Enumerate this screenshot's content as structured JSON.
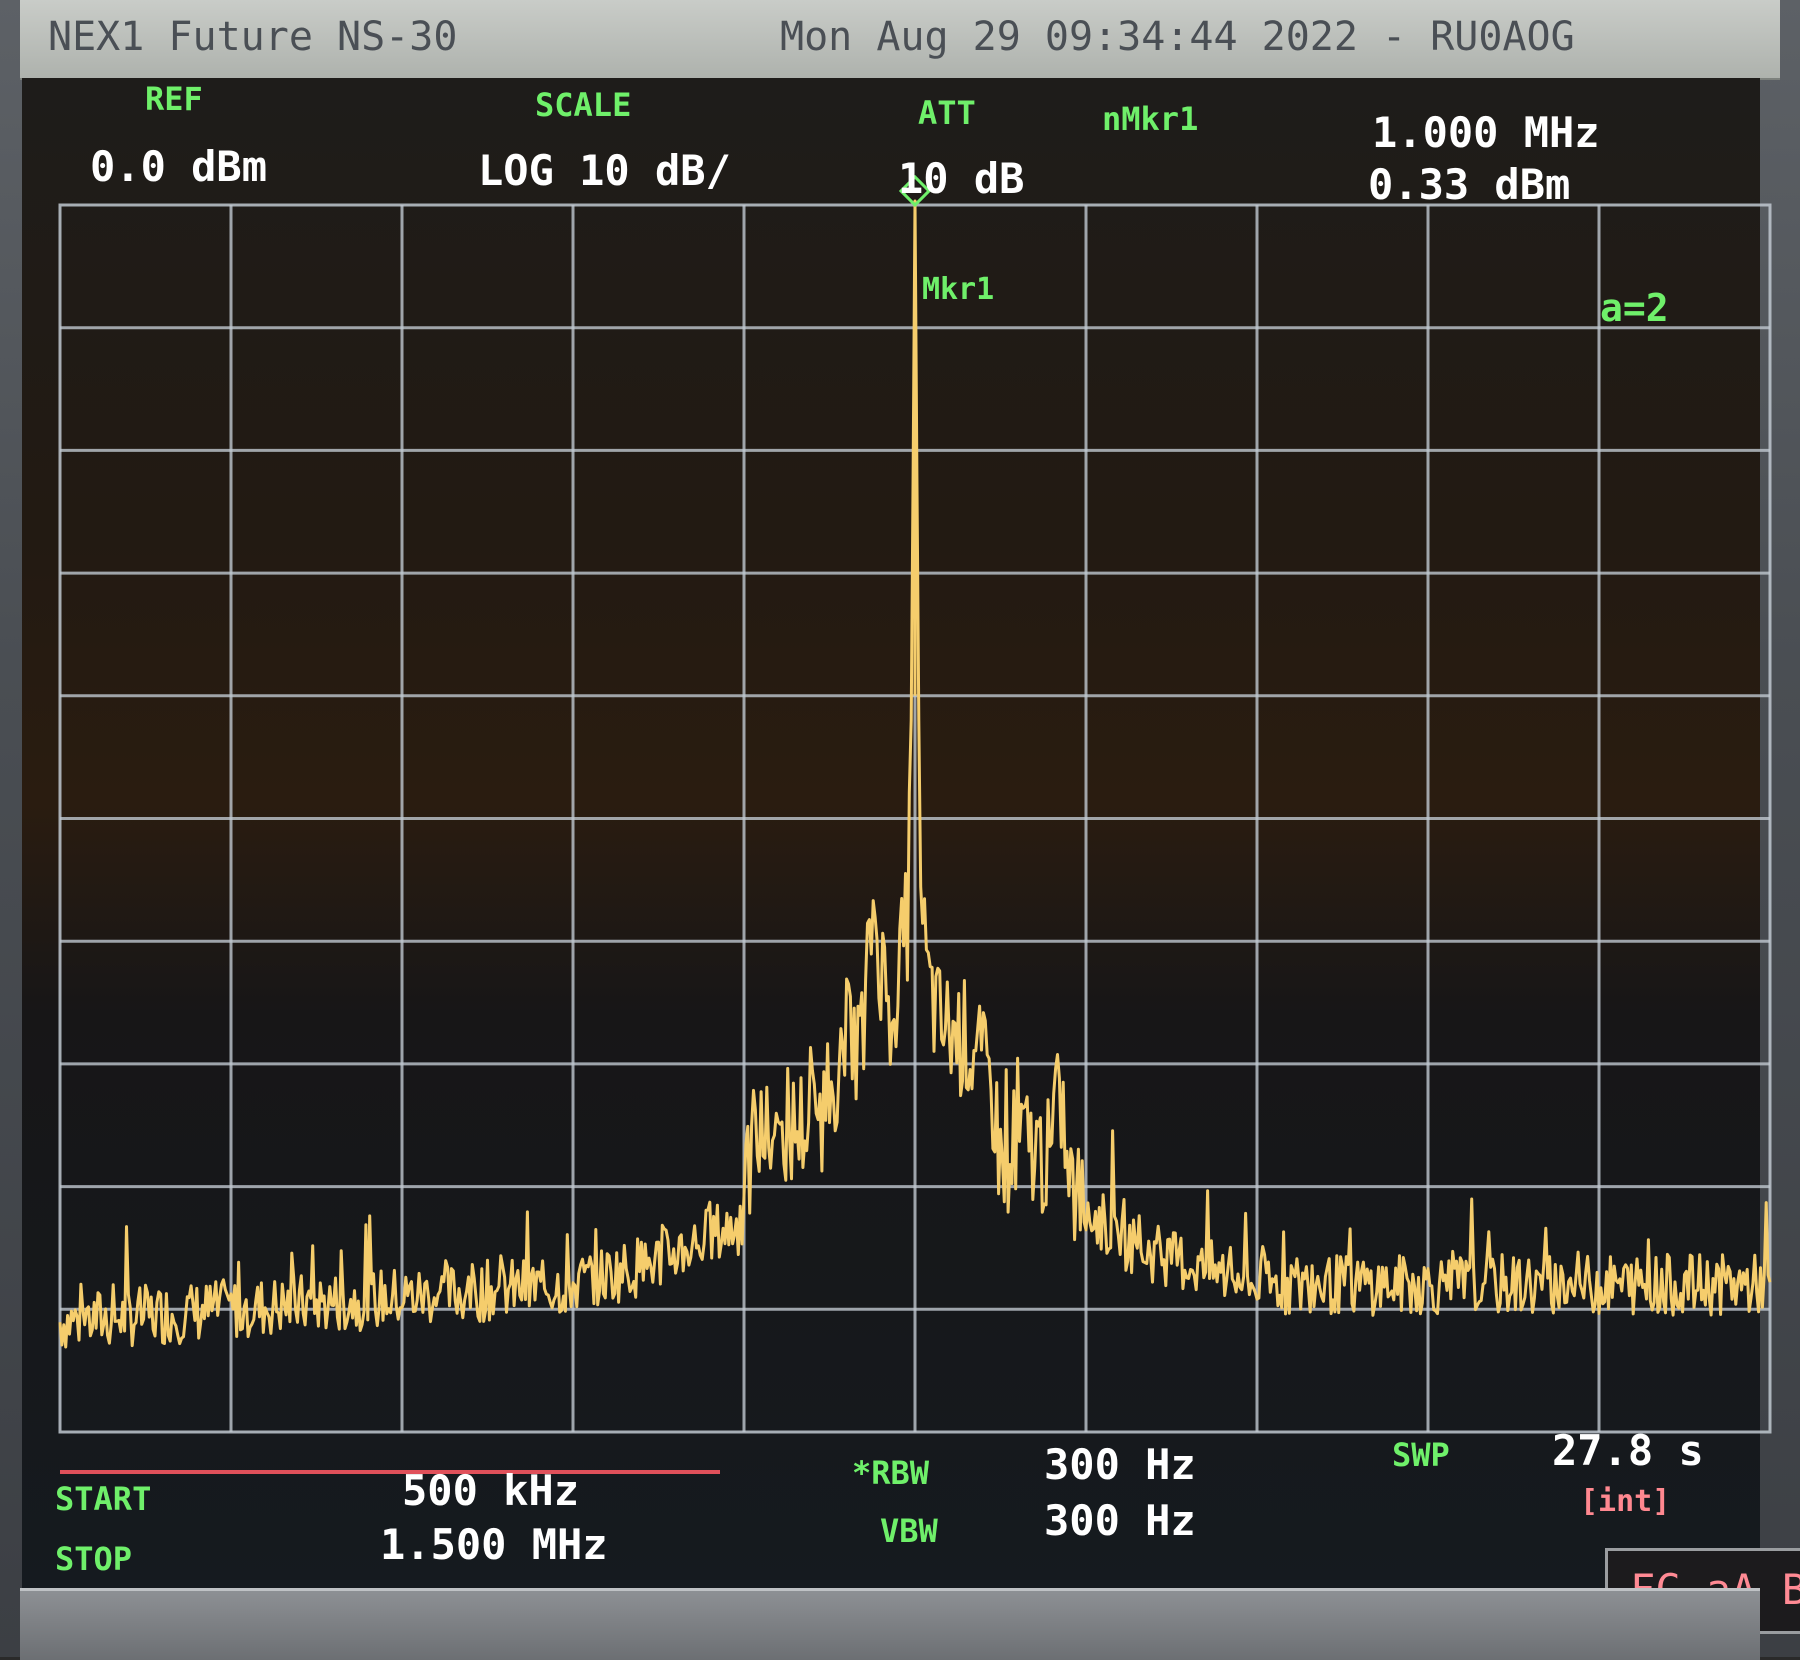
{
  "header": {
    "device": "NEX1 Future NS-30",
    "datetime": "Mon Aug 29 09:34:44 2022 - RU0AOG"
  },
  "top_labels": {
    "ref_label": "REF",
    "ref_value": "0.0 dBm",
    "scale_label": "SCALE",
    "scale_value": "LOG 10 dB/",
    "att_label": "ATT",
    "att_value": "10 dB",
    "marker_label": "nMkr1",
    "marker_freq": "1.000 MHz",
    "marker_level": "0.33 dBm"
  },
  "plot_labels": {
    "marker_tag": "Mkr1",
    "averaging": "a=2"
  },
  "bottom_labels": {
    "start_label": "START",
    "start_value": "500 kHz",
    "stop_label": "STOP",
    "stop_value": "1.500 MHz",
    "rbw_label": "*RBW",
    "rbw_value": "300 Hz",
    "vbw_label": "VBW",
    "vbw_value": "300 Hz",
    "swp_label": "SWP",
    "swp_value": "27.8 s",
    "swp_mode": "[int]"
  },
  "status": {
    "text": "FC aA B"
  },
  "colors": {
    "trace": "#f5cd6c",
    "grid": "#c0c8d0",
    "label_green": "#6ff06a",
    "label_white": "#ffffff",
    "screen_bg": "#1d1b1b"
  },
  "chart_data": {
    "type": "line",
    "xlim": [
      0.5,
      1.5
    ],
    "ylim": [
      -100,
      0
    ],
    "x_unit": "MHz",
    "y_unit": "dBm",
    "grid": true,
    "marker": {
      "name": "Mkr1",
      "x": 1.0,
      "y": 0.33
    },
    "series": [
      {
        "x": [
          0.5,
          0.6,
          0.7,
          0.8,
          0.85,
          0.88,
          0.9,
          0.905,
          0.92,
          0.945,
          0.96,
          0.97,
          0.975,
          0.985,
          0.99,
          0.996,
          0.998,
          1.0,
          1.002,
          1.004,
          1.008,
          1.015,
          1.03,
          1.045,
          1.05,
          1.06,
          1.08,
          1.085,
          1.09,
          1.1,
          1.13,
          1.2,
          1.3,
          1.4,
          1.5
        ],
        "values": [
          -91,
          -90,
          -89,
          -88,
          -86,
          -84,
          -83,
          -76,
          -76,
          -74,
          -68,
          -68,
          -57,
          -66,
          -63,
          -58,
          -40,
          0.33,
          -40,
          -58,
          -64,
          -67,
          -68,
          -72,
          -78,
          -76,
          -78,
          -72,
          -80,
          -82,
          -85,
          -88,
          -88,
          -88,
          -88
        ]
      }
    ]
  }
}
